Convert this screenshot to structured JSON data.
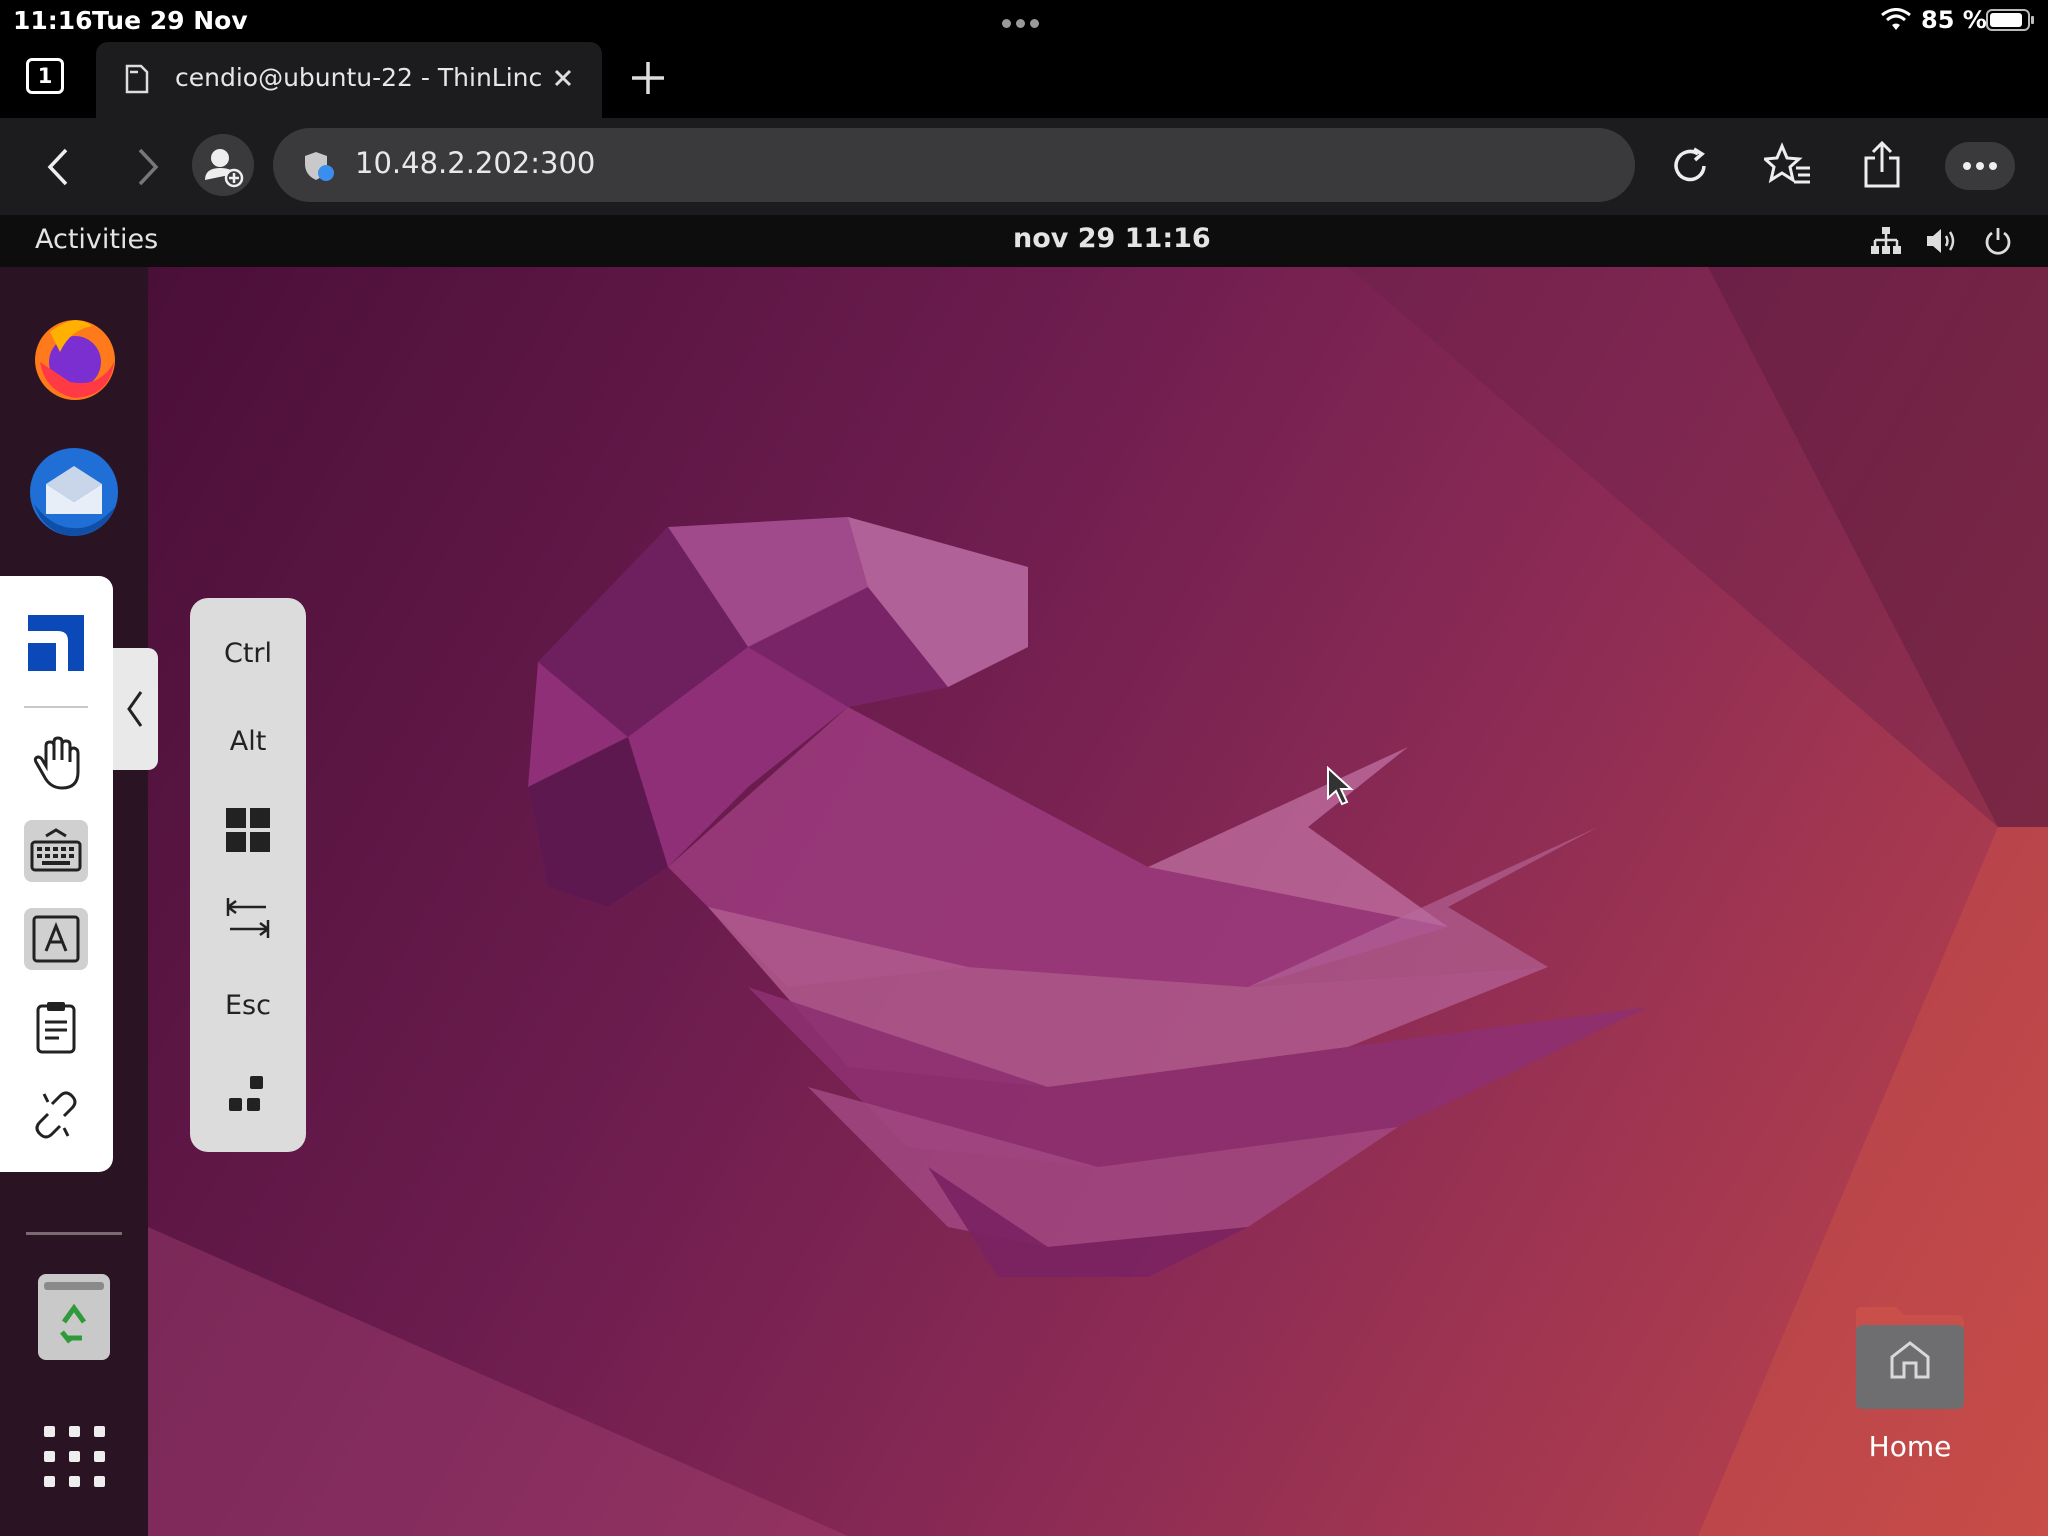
{
  "statusbar": {
    "time": "11:16",
    "date": "Tue 29 Nov",
    "battery": "85 %"
  },
  "browser": {
    "tab_count": "1",
    "tab_title": "cendio@ubuntu-22 - ThinLinc",
    "url": "10.48.2.202:300"
  },
  "gnome": {
    "activities": "Activities",
    "clock": "nov 29  11:16"
  },
  "thinlinc_keys": {
    "ctrl": "Ctrl",
    "alt": "Alt",
    "esc": "Esc"
  },
  "desktop": {
    "home_label": "Home"
  },
  "icons": {
    "dock": [
      "firefox-icon",
      "thunderbird-icon",
      "trash-icon",
      "app-grid-icon"
    ],
    "thinlinc_tools": [
      "thinlinc-logo-icon",
      "hand-icon",
      "keyboard-icon",
      "text-input-icon",
      "clipboard-icon",
      "disconnect-icon"
    ]
  },
  "colors": {
    "accent_purple": "#8a2a55",
    "dock_bg": "#2a1423",
    "toolbar_bg": "#1c1c1e"
  }
}
